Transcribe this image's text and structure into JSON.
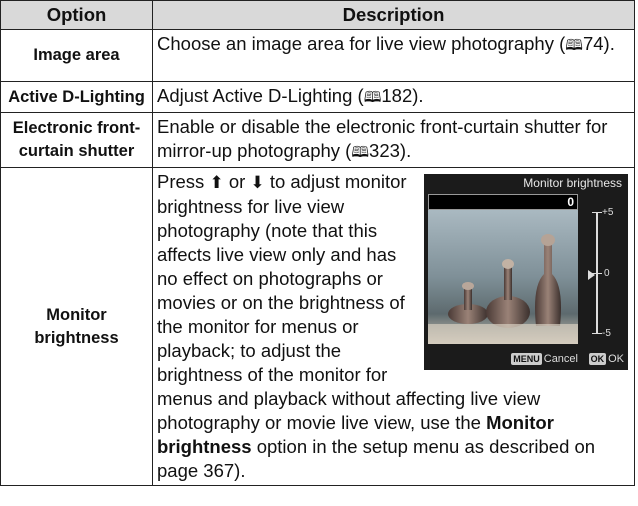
{
  "table": {
    "header": {
      "option": "Option",
      "description": "Description"
    },
    "rows": [
      {
        "option": "Image area",
        "description": "Choose an image area for live view photography",
        "ref_icon": "book-icon",
        "ref_page": "74"
      },
      {
        "option": "Active D-Lighting",
        "description": "Adjust Active D-Lighting",
        "ref_icon": "book-icon",
        "ref_page": "182"
      },
      {
        "option": "Electronic front-curtain shutter",
        "description": "Enable or disable the electronic front-curtain shutter for mirror-up photography",
        "ref_icon": "book-icon",
        "ref_page": "323"
      },
      {
        "option": "Monitor brightness",
        "text_pre": "Press",
        "up_icon": "multi-selector-up-icon",
        "text_or": "or",
        "down_icon": "multi-selector-down-icon",
        "text_main": "to adjust monitor brightness for live view photography (note that this affects live view only and has no effect on photographs or movies or on the brightness of the monitor for menus or playback; to adjust the brightness of the monitor for menus and playback without affecting live view photography or movie live view, use the",
        "bold_term": "Monitor brightness",
        "text_post": "option in the setup menu as described on page 367).",
        "screen": {
          "title": "Monitor brightness",
          "value": "0",
          "scale_top": "+5",
          "scale_mid": "0",
          "scale_bottom": "-5",
          "cancel_key": "MENU",
          "cancel_label": "Cancel",
          "ok_key": "OK",
          "ok_label": "OK"
        }
      }
    ]
  }
}
